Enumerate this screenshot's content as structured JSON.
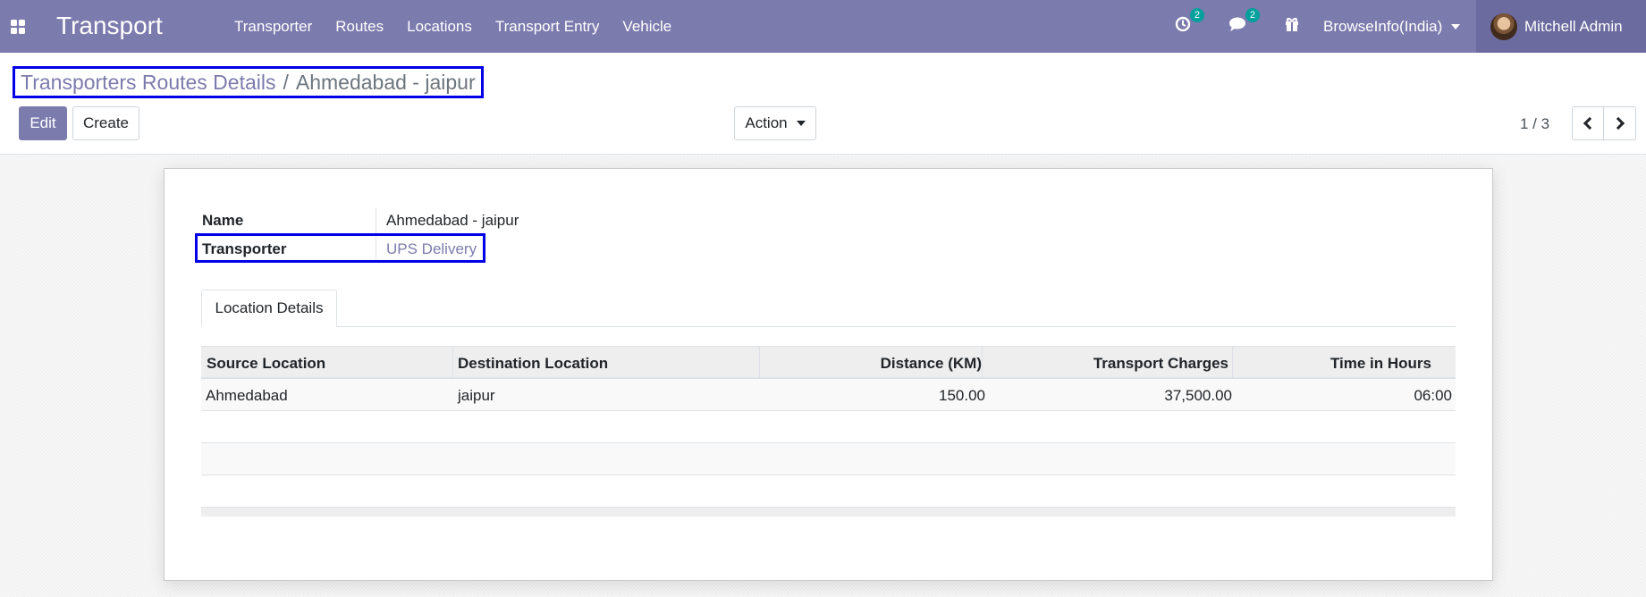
{
  "navbar": {
    "app_name": "Transport",
    "menu": [
      "Transporter",
      "Routes",
      "Locations",
      "Transport Entry",
      "Vehicle"
    ],
    "activity_count": "2",
    "message_count": "2",
    "company": "BrowseInfo(India)",
    "user": "Mitchell Admin"
  },
  "breadcrumb": {
    "parent": "Transporters Routes Details",
    "separator": "/",
    "current": "Ahmedabad - jaipur"
  },
  "toolbar": {
    "edit_label": "Edit",
    "create_label": "Create",
    "action_label": "Action",
    "pager": "1 / 3"
  },
  "form": {
    "name_label": "Name",
    "name_value": "Ahmedabad - jaipur",
    "transporter_label": "Transporter",
    "transporter_value": "UPS Delivery"
  },
  "tabs": [
    "Location Details"
  ],
  "table": {
    "columns": [
      "Source Location",
      "Destination Location",
      "Distance (KM)",
      "Transport Charges",
      "Time in Hours"
    ],
    "rows": [
      [
        "Ahmedabad",
        "jaipur",
        "150.00",
        "37,500.00",
        "06:00"
      ]
    ]
  },
  "colors": {
    "navbar": "#7c7bad",
    "accent": "#7c7bad",
    "highlight_border": "#0000e6",
    "badge": "#00a09d"
  }
}
